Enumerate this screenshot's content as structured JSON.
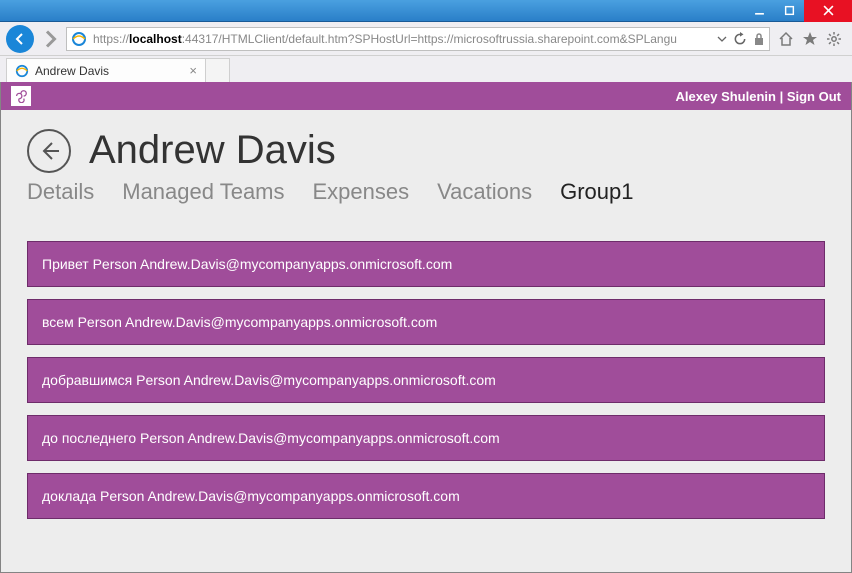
{
  "window": {
    "title": "Andrew Davis"
  },
  "browser": {
    "url_proto": "https://",
    "url_host": "localhost",
    "url_rest": ":44317/HTMLClient/default.htm?SPHostUrl=https://microsoftrussia.sharepoint.com&SPLangu",
    "tab_title": "Andrew Davis"
  },
  "sp_top": {
    "user": "Alexey Shulenin",
    "sep": " | ",
    "signout": "Sign Out"
  },
  "page": {
    "title": "Andrew Davis"
  },
  "tabs": {
    "items": [
      {
        "label": "Details",
        "active": false
      },
      {
        "label": "Managed Teams",
        "active": false
      },
      {
        "label": "Expenses",
        "active": false
      },
      {
        "label": "Vacations",
        "active": false
      },
      {
        "label": "Group1",
        "active": true
      }
    ]
  },
  "list": {
    "items": [
      {
        "text": "Привет Person Andrew.Davis@mycompanyapps.onmicrosoft.com"
      },
      {
        "text": "всем Person Andrew.Davis@mycompanyapps.onmicrosoft.com"
      },
      {
        "text": "добравшимся Person Andrew.Davis@mycompanyapps.onmicrosoft.com"
      },
      {
        "text": "до последнего Person Andrew.Davis@mycompanyapps.onmicrosoft.com"
      },
      {
        "text": "доклада Person Andrew.Davis@mycompanyapps.onmicrosoft.com"
      }
    ]
  },
  "colors": {
    "accent": "#a04d9a",
    "bg": "#ededed"
  }
}
